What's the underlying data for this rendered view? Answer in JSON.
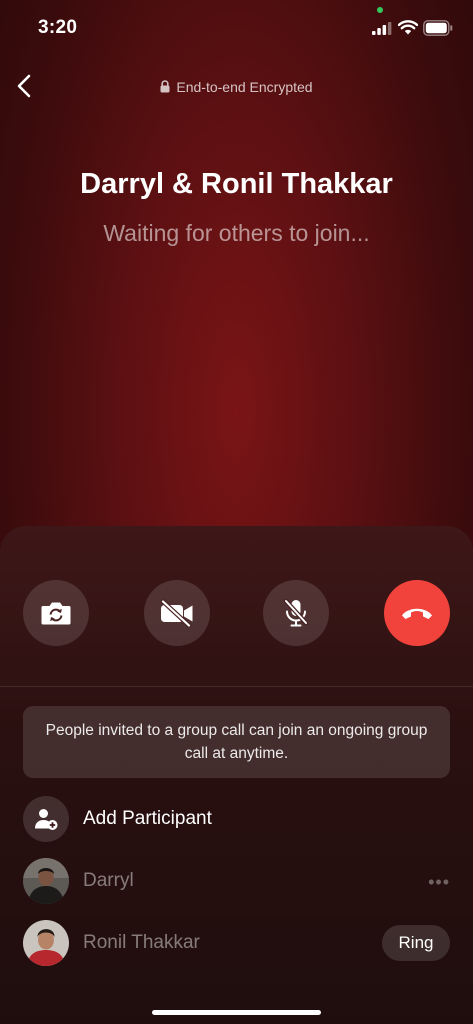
{
  "status": {
    "time": "3:20"
  },
  "header": {
    "encryption_label": "End-to-end Encrypted"
  },
  "call": {
    "title": "Darryl & Ronil Thakkar",
    "subtitle": "Waiting for others to join..."
  },
  "controls": [
    {
      "name": "flip-camera",
      "icon": "camera-rotate-icon"
    },
    {
      "name": "video-toggle",
      "icon": "video-off-icon"
    },
    {
      "name": "mute-toggle",
      "icon": "mic-off-icon"
    },
    {
      "name": "end-call",
      "icon": "phone-hangup-icon",
      "color": "#f1433c"
    }
  ],
  "notice": "People invited to a group call can join an ongoing group call at anytime.",
  "participants": {
    "add_label": "Add Participant",
    "list": [
      {
        "name": "Darryl",
        "action": "more"
      },
      {
        "name": "Ronil Thakkar",
        "action_label": "Ring"
      }
    ]
  }
}
